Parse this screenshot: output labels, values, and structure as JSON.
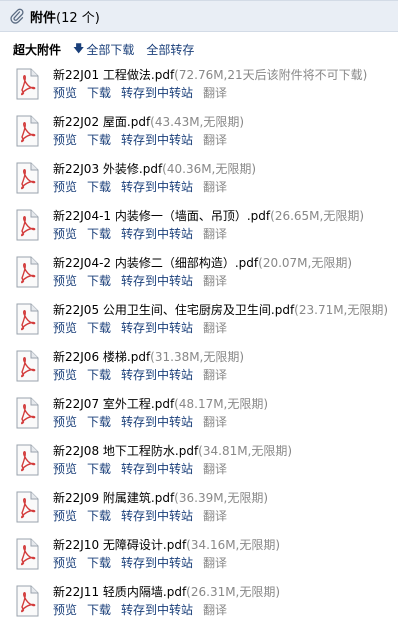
{
  "header": {
    "title": "附件",
    "count": "(12 个)"
  },
  "toolbar": {
    "label": "超大附件",
    "download_all": "全部下载",
    "save_all": "全部转存"
  },
  "actions": {
    "preview": "预览",
    "download": "下载",
    "save_to_drive": "转存到中转站",
    "translate": "翻译"
  },
  "attachments": [
    {
      "name": "新22J01 工程做法.pdf",
      "meta": "(72.76M,21天后该附件将不可下载)"
    },
    {
      "name": "新22J02 屋面.pdf",
      "meta": "(43.43M,无限期)"
    },
    {
      "name": "新22J03 外装修.pdf",
      "meta": "(40.36M,无限期)"
    },
    {
      "name": "新22J04-1 内装修一（墙面、吊顶）.pdf",
      "meta": "(26.65M,无限期)"
    },
    {
      "name": "新22J04-2 内装修二（细部构造）.pdf",
      "meta": "(20.07M,无限期)"
    },
    {
      "name": "新22J05 公用卫生间、住宅厨房及卫生间.pdf",
      "meta": "(23.71M,无限期)"
    },
    {
      "name": "新22J06 楼梯.pdf",
      "meta": "(31.38M,无限期)"
    },
    {
      "name": "新22J07 室外工程.pdf",
      "meta": "(48.17M,无限期)"
    },
    {
      "name": "新22J08 地下工程防水.pdf",
      "meta": "(34.81M,无限期)"
    },
    {
      "name": "新22J09 附属建筑.pdf",
      "meta": "(36.39M,无限期)"
    },
    {
      "name": "新22J10 无障碍设计.pdf",
      "meta": "(34.16M,无限期)"
    },
    {
      "name": "新22J11 轻质内隔墙.pdf",
      "meta": "(26.31M,无限期)"
    }
  ]
}
